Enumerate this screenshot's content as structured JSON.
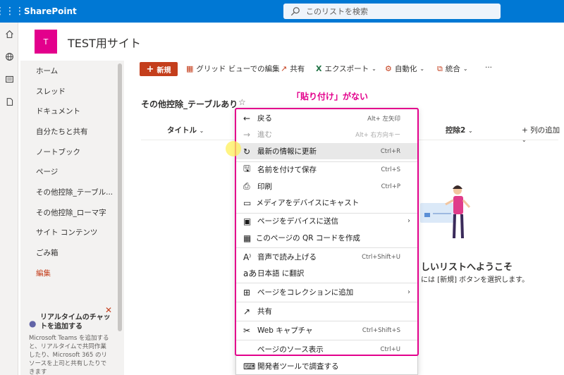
{
  "suitebar": {
    "brand": "SharePoint",
    "search_placeholder": "このリストを検索"
  },
  "site": {
    "logo_letter": "T",
    "title": "TEST用サイト"
  },
  "nav": {
    "items": [
      "ホーム",
      "スレッド",
      "ドキュメント",
      "自分たちと共有",
      "ノートブック",
      "ページ",
      "その他控除_テーブル...",
      "その他控除_ローマ字",
      "サイト コンテンツ",
      "ごみ箱"
    ],
    "edit_label": "編集"
  },
  "chat": {
    "title": "リアルタイムのチャットを追加する",
    "description": "Microsoft Teams を追加すると、リアルタイムで共同作業したり、Microsoft 365 のリソースを上司と共有したりできます"
  },
  "cmdbar": {
    "new_label": "新規",
    "grid_label": "グリッド ビューでの編集",
    "share_label": "共有",
    "export_label": "エクスポート",
    "automate_label": "自動化",
    "integrate_label": "統合",
    "more_label": "···"
  },
  "list": {
    "title": "その他控除_テーブルあり",
    "col_title": "タイトル",
    "col_3": "控除2",
    "col_add": "列の追加",
    "welcome": "しいリストへようこそ",
    "welcome_sub": "には [新規] ボタンを選択します。"
  },
  "annotation": "「貼り付け」がない",
  "menu": {
    "items": [
      {
        "label": "戻る",
        "key": "Alt+ 左矢印",
        "icon": "arrow-left"
      },
      {
        "label": "進む",
        "key": "Alt+ 右方向キー",
        "icon": "arrow-right"
      },
      {
        "label": "最新の情報に更新",
        "key": "Ctrl+R",
        "icon": "refresh"
      },
      {
        "label": "名前を付けて保存",
        "key": "Ctrl+S",
        "icon": "save"
      },
      {
        "label": "印刷",
        "key": "Ctrl+P",
        "icon": "print"
      },
      {
        "label": "メディアをデバイスにキャスト",
        "key": "",
        "icon": "cast"
      },
      {
        "label": "ページをデバイスに送信",
        "key": "",
        "icon": "send-device"
      },
      {
        "label": "このページの QR コードを作成",
        "key": "",
        "icon": "qr"
      },
      {
        "label": "音声で読み上げる",
        "key": "Ctrl+Shift+U",
        "icon": "read-aloud"
      },
      {
        "label": "日本語 に翻訳",
        "key": "",
        "icon": "translate"
      },
      {
        "label": "ページをコレクションに追加",
        "key": "",
        "icon": "collection"
      },
      {
        "label": "共有",
        "key": "",
        "icon": "share"
      },
      {
        "label": "Web キャプチャ",
        "key": "Ctrl+Shift+S",
        "icon": "web-capture"
      },
      {
        "label": "ページのソース表示",
        "key": "Ctrl+U",
        "icon": "source"
      },
      {
        "label": "開発者ツールで調査する",
        "key": "",
        "icon": "devtools"
      }
    ]
  },
  "colors": {
    "suitebar": "#0078d4",
    "accent": "#c43e1c",
    "logo": "#e3008c",
    "annotation": "#e3008c"
  }
}
